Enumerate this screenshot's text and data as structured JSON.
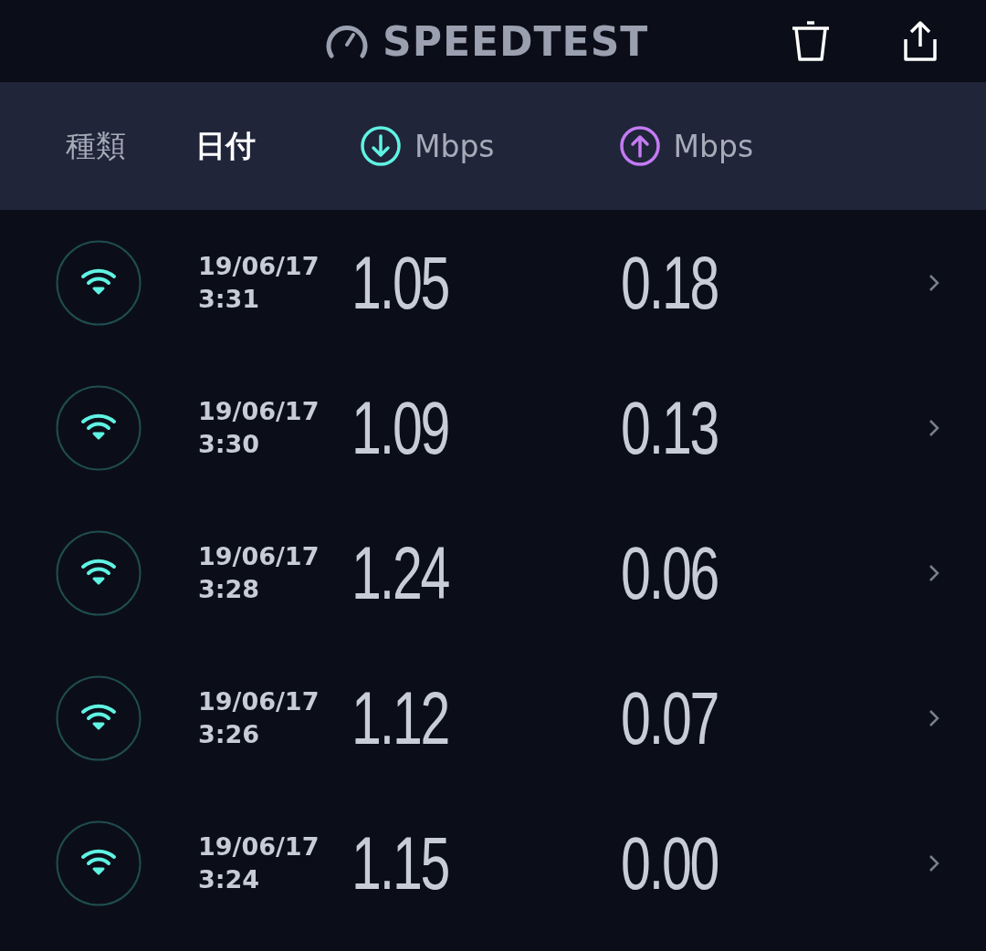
{
  "header": {
    "title": "SPEEDTEST"
  },
  "columns": [
    {
      "kind": "text",
      "label": "種類",
      "selected": false
    },
    {
      "kind": "text",
      "label": "日付",
      "selected": true
    },
    {
      "kind": "download",
      "label": "Mbps",
      "selected": false
    },
    {
      "kind": "upload",
      "label": "Mbps",
      "selected": false
    }
  ],
  "rows": [
    {
      "date": "19/06/17",
      "time": "3:31",
      "download": "1.05",
      "upload": "0.18"
    },
    {
      "date": "19/06/17",
      "time": "3:30",
      "download": "1.09",
      "upload": "0.13"
    },
    {
      "date": "19/06/17",
      "time": "3:28",
      "download": "1.24",
      "upload": "0.06"
    },
    {
      "date": "19/06/17",
      "time": "3:26",
      "download": "1.12",
      "upload": "0.07"
    },
    {
      "date": "19/06/17",
      "time": "3:24",
      "download": "1.15",
      "upload": "0.00"
    }
  ]
}
